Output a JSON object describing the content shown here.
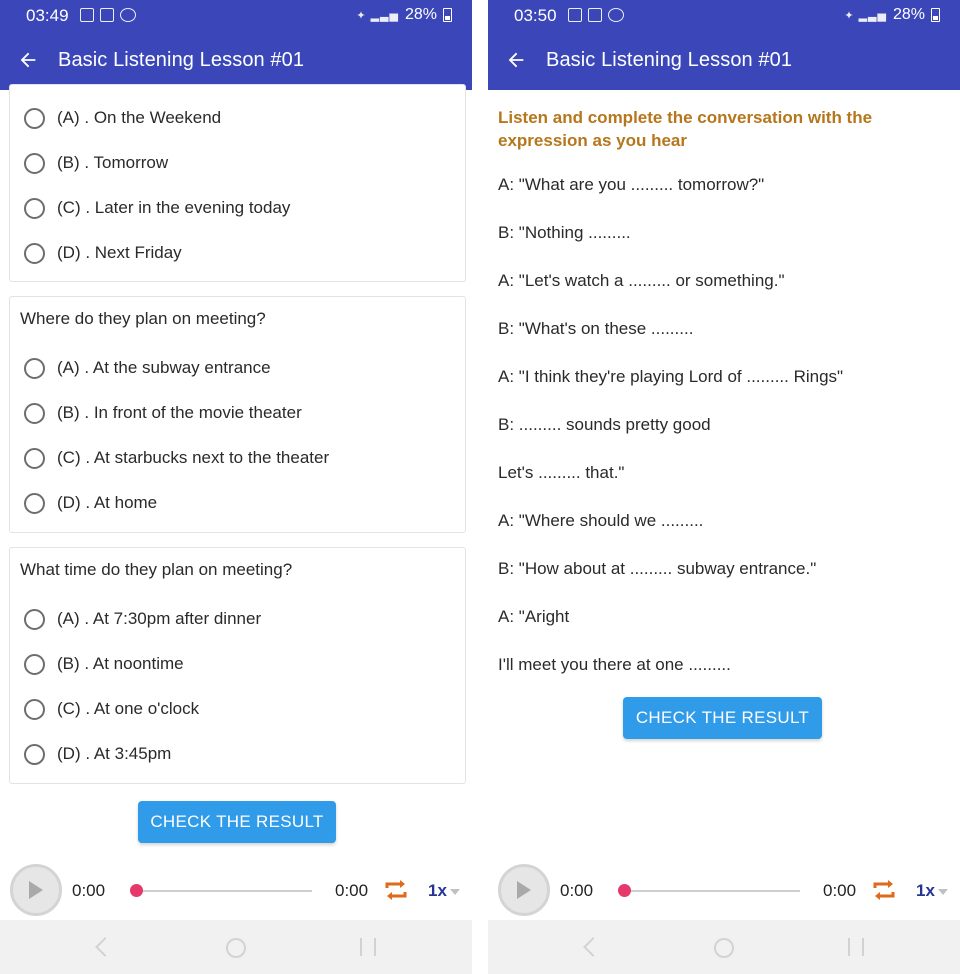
{
  "screens": {
    "left": {
      "status": {
        "time": "03:49",
        "battery": "28%"
      },
      "title": "Basic Listening Lesson #01",
      "q1_options": [
        "(A) . On the Weekend",
        "(B) . Tomorrow",
        "(C) . Later in the evening today",
        "(D) . Next Friday"
      ],
      "q2": {
        "question": "Where do they plan on meeting?",
        "options": [
          "(A) . At the subway entrance",
          "(B) . In front of the movie theater",
          "(C) . At starbucks next to the theater",
          "(D) . At home"
        ]
      },
      "q3": {
        "question": "What time do they plan on meeting?",
        "options": [
          "(A) . At 7:30pm after dinner",
          "(B) . At noontime",
          "(C) . At one o'clock",
          "(D) . At 3:45pm"
        ]
      },
      "check_label": "CHECK THE RESULT",
      "player": {
        "current": "0:00",
        "total": "0:00",
        "speed": "1x",
        "progress": 0
      }
    },
    "right": {
      "status": {
        "time": "03:50",
        "battery": "28%"
      },
      "title": "Basic Listening Lesson #01",
      "instruction": "Listen and complete the conversation with the expression as you hear",
      "lines": [
        "A: \"What are you ......... tomorrow?\"",
        "B: \"Nothing .........",
        "A: \"Let's watch a ......... or something.\"",
        "B: \"What's on these .........",
        "A: \"I think they're playing Lord of ......... Rings\"",
        "B: ......... sounds pretty good",
        "Let's ......... that.\"",
        "A: \"Where should we .........",
        "B: \"How about at ......... subway entrance.\"",
        "A: \"Aright",
        "I'll meet you there at one ........."
      ],
      "check_label": "CHECK THE RESULT",
      "player": {
        "current": "0:00",
        "total": "0:00",
        "speed": "1x",
        "progress": 0
      }
    }
  },
  "colors": {
    "appbar": "#3b47b9",
    "button": "#2f9be9",
    "instruction": "#b6761c",
    "seek_thumb": "#e5396c",
    "repeat": "#e06a1b",
    "speed": "#263494"
  },
  "icons": [
    "back-arrow-icon",
    "radio-icon",
    "play-icon",
    "repeat-icon",
    "chevron-down-icon"
  ]
}
